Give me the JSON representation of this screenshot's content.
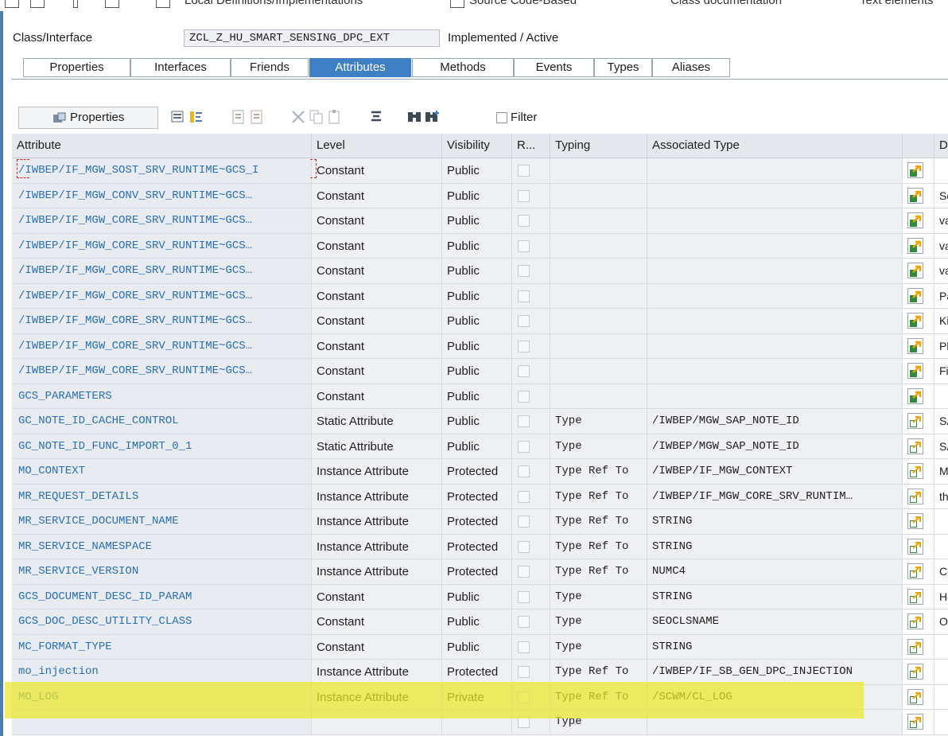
{
  "toolbar": {
    "items": [
      "Local Definitions/Implementations",
      "Source Code-Based",
      "Class documentation",
      "Text elements"
    ]
  },
  "header": {
    "label": "Class/Interface",
    "class_name": "ZCL_Z_HU_SMART_SENSING_DPC_EXT",
    "status": "Implemented / Active"
  },
  "tabs": [
    "Properties",
    "Interfaces",
    "Friends",
    "Attributes",
    "Methods",
    "Events",
    "Types",
    "Aliases"
  ],
  "active_tab": "Attributes",
  "table_toolbar": {
    "properties_label": "Properties",
    "filter_label": "Filter"
  },
  "columns": [
    "Attribute",
    "Level",
    "Visibility",
    "R...",
    "Typing",
    "Associated Type",
    "",
    "D"
  ],
  "rows": [
    {
      "attr": "/IWBEP/IF_MGW_SOST_SRV_RUNTIME~GCS_I",
      "level": "Constant",
      "vis": "Public",
      "typing": "",
      "assoc": "",
      "desc": "",
      "btn": "filled"
    },
    {
      "attr": "/IWBEP/IF_MGW_CONV_SRV_RUNTIME~GCS…",
      "level": "Constant",
      "vis": "Public",
      "typing": "",
      "assoc": "",
      "desc": "Sc",
      "btn": "filled"
    },
    {
      "attr": "/IWBEP/IF_MGW_CORE_SRV_RUNTIME~GCS…",
      "level": "Constant",
      "vis": "Public",
      "typing": "",
      "assoc": "",
      "desc": "va",
      "btn": "filled"
    },
    {
      "attr": "/IWBEP/IF_MGW_CORE_SRV_RUNTIME~GCS…",
      "level": "Constant",
      "vis": "Public",
      "typing": "",
      "assoc": "",
      "desc": "va",
      "btn": "filled"
    },
    {
      "attr": "/IWBEP/IF_MGW_CORE_SRV_RUNTIME~GCS…",
      "level": "Constant",
      "vis": "Public",
      "typing": "",
      "assoc": "",
      "desc": "va",
      "btn": "filled"
    },
    {
      "attr": "/IWBEP/IF_MGW_CORE_SRV_RUNTIME~GCS…",
      "level": "Constant",
      "vis": "Public",
      "typing": "",
      "assoc": "",
      "desc": "Pa",
      "btn": "filled"
    },
    {
      "attr": "/IWBEP/IF_MGW_CORE_SRV_RUNTIME~GCS…",
      "level": "Constant",
      "vis": "Public",
      "typing": "",
      "assoc": "",
      "desc": "Ki",
      "btn": "filled"
    },
    {
      "attr": "/IWBEP/IF_MGW_CORE_SRV_RUNTIME~GCS…",
      "level": "Constant",
      "vis": "Public",
      "typing": "",
      "assoc": "",
      "desc": "Pl",
      "btn": "filled"
    },
    {
      "attr": "/IWBEP/IF_MGW_CORE_SRV_RUNTIME~GCS…",
      "level": "Constant",
      "vis": "Public",
      "typing": "",
      "assoc": "",
      "desc": "Fil",
      "btn": "filled"
    },
    {
      "attr": "GCS_PARAMETERS",
      "level": "Constant",
      "vis": "Public",
      "typing": "",
      "assoc": "",
      "desc": "",
      "btn": "filled"
    },
    {
      "attr": "GC_NOTE_ID_CACHE_CONTROL",
      "level": "Static Attribute",
      "vis": "Public",
      "typing": "Type",
      "assoc": "/IWBEP/MGW_SAP_NOTE_ID",
      "desc": "SA",
      "btn": "outline"
    },
    {
      "attr": "GC_NOTE_ID_FUNC_IMPORT_0_1",
      "level": "Static Attribute",
      "vis": "Public",
      "typing": "Type",
      "assoc": "/IWBEP/MGW_SAP_NOTE_ID",
      "desc": "SA",
      "btn": "outline"
    },
    {
      "attr": "MO_CONTEXT",
      "level": "Instance Attribute",
      "vis": "Protected",
      "typing": "Type Ref To",
      "assoc": "/IWBEP/IF_MGW_CONTEXT",
      "desc": "M",
      "btn": "outline"
    },
    {
      "attr": "MR_REQUEST_DETAILS",
      "level": "Instance Attribute",
      "vis": "Protected",
      "typing": "Type Ref To",
      "assoc": "/IWBEP/IF_MGW_CORE_SRV_RUNTIM…",
      "desc": "th",
      "btn": "outline"
    },
    {
      "attr": "MR_SERVICE_DOCUMENT_NAME",
      "level": "Instance Attribute",
      "vis": "Protected",
      "typing": "Type Ref To",
      "assoc": "STRING",
      "desc": "",
      "btn": "outline"
    },
    {
      "attr": "MR_SERVICE_NAMESPACE",
      "level": "Instance Attribute",
      "vis": "Protected",
      "typing": "Type Ref To",
      "assoc": "STRING",
      "desc": "",
      "btn": "outline"
    },
    {
      "attr": "MR_SERVICE_VERSION",
      "level": "Instance Attribute",
      "vis": "Protected",
      "typing": "Type Ref To",
      "assoc": "NUMC4",
      "desc": "Co",
      "btn": "outline"
    },
    {
      "attr": "GCS_DOCUMENT_DESC_ID_PARAM",
      "level": "Constant",
      "vis": "Public",
      "typing": "Type",
      "assoc": "STRING",
      "desc": "He",
      "btn": "outline"
    },
    {
      "attr": "GCS_DOC_DESC_UTILITY_CLASS",
      "level": "Constant",
      "vis": "Public",
      "typing": "Type",
      "assoc": "SEOCLSNAME",
      "desc": "O",
      "btn": "outline"
    },
    {
      "attr": "MC_FORMAT_TYPE",
      "level": "Constant",
      "vis": "Public",
      "typing": "Type",
      "assoc": "STRING",
      "desc": "",
      "btn": "outline"
    },
    {
      "attr": "mo_injection",
      "level": "Instance Attribute",
      "vis": "Protected",
      "typing": "Type Ref To",
      "assoc": "/IWBEP/IF_SB_GEN_DPC_INJECTION",
      "desc": "",
      "btn": "outline"
    },
    {
      "attr": "MO_LOG",
      "level": "Instance Attribute",
      "vis": "Private",
      "typing": "Type Ref To",
      "assoc": "/SCWM/CL_LOG",
      "desc": "",
      "btn": "outline"
    },
    {
      "attr": "",
      "level": "",
      "vis": "",
      "typing": "Type",
      "assoc": "",
      "desc": "",
      "btn": "outline"
    }
  ],
  "colors": {
    "active_tab": "#3f7fc4",
    "attribute_text": "#2a6fb4",
    "highlight": "#ece828"
  }
}
